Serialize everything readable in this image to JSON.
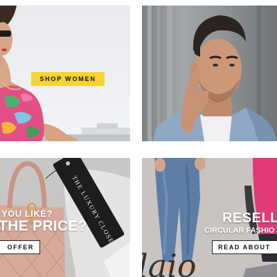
{
  "tiles": {
    "women": {
      "cta_label": "SHOP WOMEN"
    },
    "men": {},
    "offer": {
      "headline_line1": "YOU LIKE?",
      "headline_line2": "THE PRICE?",
      "cta_label": "OFFER",
      "tag_text": "THE LUXURY CLOSET"
    },
    "resell": {
      "headline": "RESELL",
      "subheadline": "CIRCULAR FASHIO",
      "cta_label": "READ ABOUT",
      "logo_text": "laio"
    }
  },
  "colors": {
    "cta_yellow": "#f7d331",
    "cta_white": "#ffffff",
    "text_dark": "#111111",
    "headline_white": "#ffffff"
  },
  "icons": []
}
